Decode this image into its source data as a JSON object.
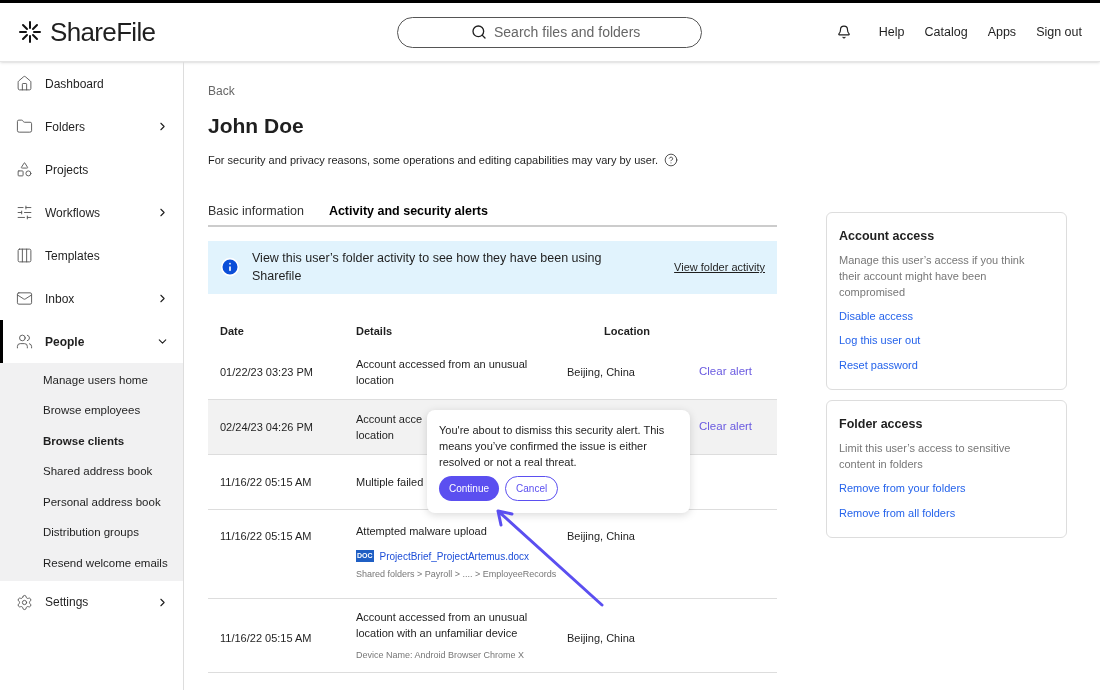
{
  "header": {
    "logo": "ShareFile",
    "search": {
      "placeholder": "Search files and folders"
    },
    "links": [
      "Help",
      "Catalog",
      "Apps",
      "Sign out"
    ]
  },
  "sidebar": {
    "items": [
      {
        "label": "Dashboard",
        "selected": false
      },
      {
        "label": "Folders",
        "selected": false,
        "expanded": false
      },
      {
        "label": "Projects",
        "selected": false
      },
      {
        "label": "Workflows",
        "selected": false,
        "expanded": false
      },
      {
        "label": "Templates",
        "selected": false
      },
      {
        "label": "Inbox",
        "selected": false,
        "expanded": false
      },
      {
        "label": "People",
        "selected": true,
        "expanded": true,
        "children": [
          {
            "label": "Manage users home",
            "selected": false
          },
          {
            "label": "Browse employees",
            "selected": false
          },
          {
            "label": "Browse clients",
            "selected": true
          },
          {
            "label": "Shared address book",
            "selected": false
          },
          {
            "label": "Personal address book",
            "selected": false
          },
          {
            "label": "Distribution groups",
            "selected": false
          },
          {
            "label": "Resend welcome emails",
            "selected": false
          }
        ]
      },
      {
        "label": "Settings",
        "selected": false,
        "expanded": false
      }
    ]
  },
  "page": {
    "back": "Back",
    "title": "John Doe",
    "subtitle": "For security and privacy reasons, some operations and editing capabilities may vary by user.",
    "tabs": [
      {
        "label": "Basic information",
        "selected": false
      },
      {
        "label": "Activity and security alerts",
        "selected": true
      }
    ],
    "banner": {
      "text": "View this user’s folder activity to see how they have been using Sharefile",
      "link": "View folder activity"
    },
    "table": {
      "columns": [
        "Date",
        "Details",
        "Location"
      ],
      "rows": [
        {
          "date": "01/22/23 03:23 PM",
          "details": "Account accessed from an unusual location",
          "location": "Beijing, China",
          "action": "Clear alert",
          "highlighted": false
        },
        {
          "date": "02/24/23 04:26 PM",
          "details": "Account acce\nlocation",
          "action": "Clear alert",
          "highlighted": true
        },
        {
          "date": "11/16/22 05:15 AM",
          "details": "Multiple failed",
          "highlighted": false
        },
        {
          "date": "11/16/22 05:15 AM",
          "details": "Attempted malware upload",
          "location": "Beijing, China",
          "file": {
            "badge": "DOC",
            "name": "ProjectBrief_ProjectArtemus.docx",
            "path": "Shared folders > Payroll > .... > EmployeeRecords"
          },
          "highlighted": false
        },
        {
          "date": "11/16/22 05:15 AM",
          "details": "Account accessed from an unusual location with an unfamiliar device",
          "location": "Beijing, China",
          "note": "Device Name: Android Browser Chrome X",
          "highlighted": false
        }
      ]
    },
    "popover": {
      "text": "You're about to dismiss this security alert. This means you’ve confirmed the issue is either resolved or not a real threat.",
      "confirm": "Continue",
      "cancel": "Cancel"
    }
  },
  "cards": [
    {
      "title": "Account access",
      "text": "Manage this user’s access if you think their account might have been compromised",
      "links": [
        "Disable access",
        "Log this user out",
        "Reset password"
      ]
    },
    {
      "title": "Folder access",
      "text": "Limit this user’s access to sensitive content in folders",
      "links": [
        "Remove from your folders",
        "Remove from all folders"
      ]
    }
  ]
}
